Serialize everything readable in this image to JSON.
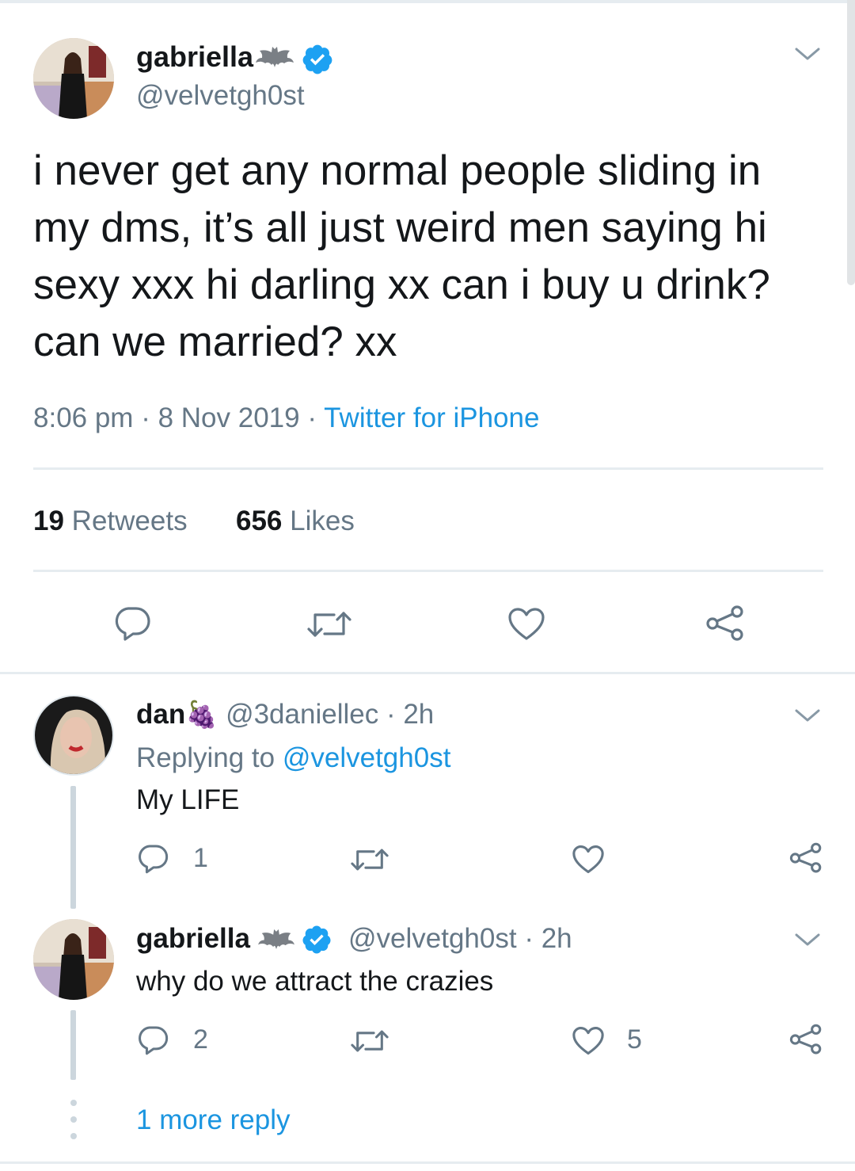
{
  "main_tweet": {
    "name": "gabriella",
    "handle": "@velvetgh0st",
    "text_lines": [
      "i never get any normal people sliding in",
      "my dms, it’s all just weird men saying hi",
      "sexy xxx hi darling xx can i buy u drink?",
      "can we married? xx"
    ],
    "time": "8:06 pm",
    "date": "8 Nov 2019",
    "separator": "·",
    "source": "Twitter for iPhone",
    "retweets_count": "19",
    "retweets_label": "Retweets",
    "likes_count": "656",
    "likes_label": "Likes"
  },
  "replies": [
    {
      "name": "dan",
      "emoji": "🍇",
      "handle": "@3daniellec",
      "time": "· 2h",
      "replying_label": "Replying to",
      "replying_handle": "@velvetgh0st",
      "text": "My LIFE",
      "reply_count": "1",
      "retweet_count": "",
      "like_count": ""
    },
    {
      "name": "gabriella",
      "handle": "@velvetgh0st",
      "time": "· 2h",
      "text": "why do we attract the crazies",
      "reply_count": "2",
      "retweet_count": "",
      "like_count": "5"
    }
  ],
  "more_replies": "1 more reply",
  "colors": {
    "accent": "#1b95e0",
    "verified": "#1da1f2",
    "muted": "#657786",
    "divider": "#e6ecf0"
  },
  "icons": [
    "bat-icon",
    "verified-badge-icon",
    "chevron-down-icon",
    "reply-icon",
    "retweet-icon",
    "like-icon",
    "share-icon"
  ]
}
